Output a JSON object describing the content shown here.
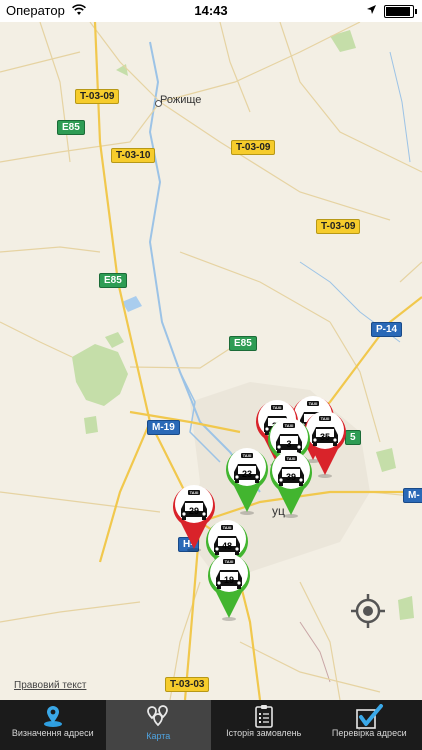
{
  "status_bar": {
    "carrier": "Оператор",
    "time": "14:43"
  },
  "map": {
    "town_label": "Рожище",
    "city_label_partial": "уц",
    "legal_link": "Правовий текст",
    "road_labels": {
      "t0309_a": "T-03-09",
      "e85_a": "E85",
      "t0310": "T-03-10",
      "t0309_b": "T-03-09",
      "t0309_c": "T-03-09",
      "e85_b": "E85",
      "p14": "P-14",
      "e85_c": "E85",
      "m19": "M-19",
      "e5": "5",
      "m_right": "M-",
      "h_left": "H-",
      "t0303": "T-03-03"
    },
    "taxi_pins": [
      {
        "number": "35",
        "status": "red"
      },
      {
        "number": "3",
        "status": "green"
      },
      {
        "number": "23",
        "status": "green"
      },
      {
        "number": "39",
        "status": "green"
      },
      {
        "number": "29",
        "status": "red"
      },
      {
        "number": "48",
        "status": "green"
      },
      {
        "number": "19",
        "status": "green"
      }
    ],
    "taxi_sign_text": "TAXI"
  },
  "colors": {
    "pin_red": "#d9232a",
    "pin_green": "#42b52f",
    "tab_active": "#4fa3e0"
  },
  "tabs": [
    {
      "label": "Визначення адреси",
      "icon": "map-pin-icon"
    },
    {
      "label": "Карта",
      "icon": "multi-pin-icon"
    },
    {
      "label": "Історія замовлень",
      "icon": "checklist-icon"
    },
    {
      "label": "Перевірка адреси",
      "icon": "checkbox-icon"
    }
  ]
}
